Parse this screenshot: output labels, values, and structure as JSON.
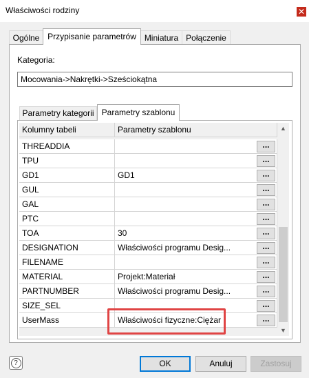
{
  "window": {
    "title": "Właściwości rodziny",
    "close_glyph": "✕"
  },
  "tabs": [
    {
      "label": "Ogólne"
    },
    {
      "label": "Przypisanie parametrów"
    },
    {
      "label": "Miniatura"
    },
    {
      "label": "Połączenie"
    }
  ],
  "category": {
    "label": "Kategoria:",
    "value": "Mocowania->Nakrętki->Sześciokątna"
  },
  "subtabs": [
    {
      "label": "Parametry kategorii"
    },
    {
      "label": "Parametry szablonu"
    }
  ],
  "grid": {
    "headers": [
      "Kolumny tabeli",
      "Parametry szablonu"
    ],
    "ellipsis": "...",
    "rows": [
      {
        "column": "THREADDIA",
        "param": ""
      },
      {
        "column": "TPU",
        "param": ""
      },
      {
        "column": "GD1",
        "param": "GD1"
      },
      {
        "column": "GUL",
        "param": ""
      },
      {
        "column": "GAL",
        "param": ""
      },
      {
        "column": "PTC",
        "param": ""
      },
      {
        "column": "TOA",
        "param": "30"
      },
      {
        "column": "DESIGNATION",
        "param": "Właściwości programu Desig..."
      },
      {
        "column": "FILENAME",
        "param": ""
      },
      {
        "column": "MATERIAL",
        "param": "Projekt:Materiał"
      },
      {
        "column": "PARTNUMBER",
        "param": "Właściwości programu Desig..."
      },
      {
        "column": "SIZE_SEL",
        "param": ""
      },
      {
        "column": "UserMass",
        "param": "Właściwości fizyczne:Ciężar"
      }
    ]
  },
  "buttons": {
    "help_glyph": "?",
    "ok": "OK",
    "cancel": "Anuluj",
    "apply": "Zastosuj"
  },
  "colors": {
    "highlight": "#e04444",
    "ok_border": "#0078d7",
    "close_bg": "#c42b1c"
  }
}
